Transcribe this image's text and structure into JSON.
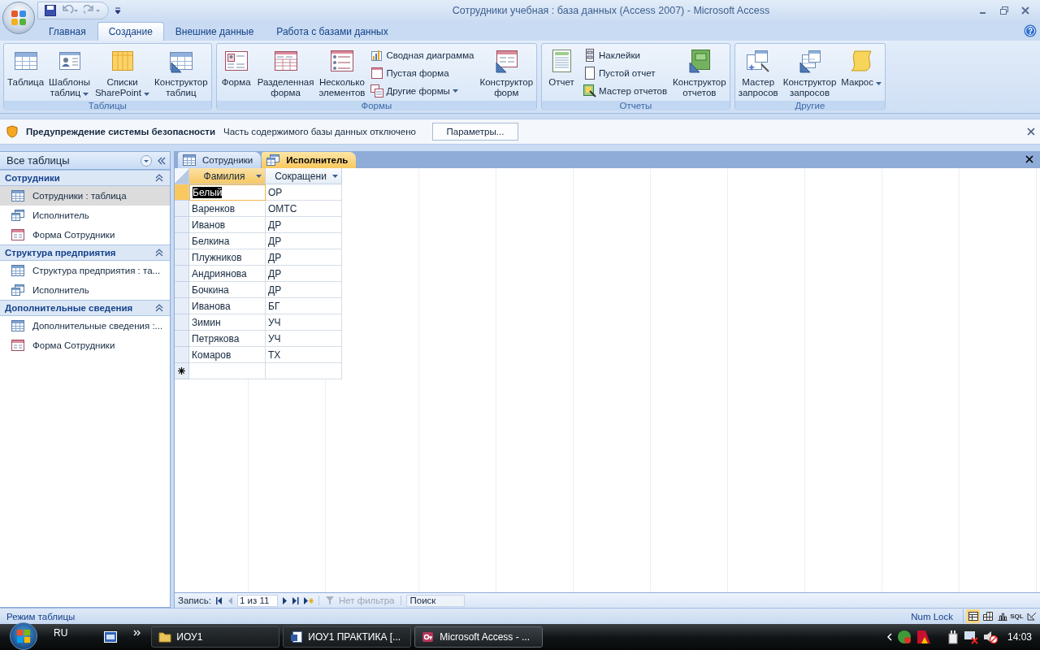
{
  "window": {
    "title": "Сотрудники учебная : база данных (Access 2007) - Microsoft Access"
  },
  "ribbon_tabs": [
    {
      "label": "Главная",
      "selected": false
    },
    {
      "label": "Создание",
      "selected": true
    },
    {
      "label": "Внешние данные",
      "selected": false
    },
    {
      "label": "Работа с базами данных",
      "selected": false
    }
  ],
  "ribbon_groups": [
    {
      "label": "Таблицы",
      "items": [
        {
          "label": "Таблица",
          "kind": "large",
          "dropdown": false
        },
        {
          "label": "Шаблоны\nтаблиц",
          "kind": "large",
          "dropdown": true
        },
        {
          "label": "Списки\nSharePoint",
          "kind": "large",
          "dropdown": true
        },
        {
          "label": "Конструктор\nтаблиц",
          "kind": "large",
          "dropdown": false
        }
      ]
    },
    {
      "label": "Формы",
      "items": [
        {
          "label": "Форма",
          "kind": "large",
          "dropdown": false
        },
        {
          "label": "Разделенная\nформа",
          "kind": "large",
          "dropdown": false
        },
        {
          "label": "Несколько\nэлементов",
          "kind": "large",
          "dropdown": false
        },
        {
          "label": "Сводная диаграмма",
          "kind": "small",
          "dropdown": false
        },
        {
          "label": "Пустая форма",
          "kind": "small",
          "dropdown": false
        },
        {
          "label": "Другие формы",
          "kind": "small",
          "dropdown": true
        },
        {
          "label": "Конструктор\nформ",
          "kind": "large",
          "dropdown": false
        }
      ]
    },
    {
      "label": "Отчеты",
      "items": [
        {
          "label": "Отчет",
          "kind": "large",
          "dropdown": false
        },
        {
          "label": "Наклейки",
          "kind": "small",
          "dropdown": false
        },
        {
          "label": "Пустой отчет",
          "kind": "small",
          "dropdown": false
        },
        {
          "label": "Мастер отчетов",
          "kind": "small",
          "dropdown": false
        },
        {
          "label": "Конструктор\nотчетов",
          "kind": "large",
          "dropdown": false
        }
      ]
    },
    {
      "label": "Другие",
      "items": [
        {
          "label": "Мастер\nзапросов",
          "kind": "large",
          "dropdown": false
        },
        {
          "label": "Конструктор\nзапросов",
          "kind": "large",
          "dropdown": false
        },
        {
          "label": "Макрос",
          "kind": "large",
          "dropdown": true
        }
      ]
    }
  ],
  "security_bar": {
    "title": "Предупреждение системы безопасности",
    "message": "Часть содержимого базы данных отключено",
    "button": "Параметры..."
  },
  "nav_pane": {
    "header": "Все таблицы",
    "groups": [
      {
        "label": "Сотрудники",
        "items": [
          {
            "label": "Сотрудники : таблица",
            "kind": "table",
            "selected": true
          },
          {
            "label": "Исполнитель",
            "kind": "query",
            "selected": false
          },
          {
            "label": "Форма Сотрудники",
            "kind": "form",
            "selected": false
          }
        ]
      },
      {
        "label": "Структура предприятия",
        "items": [
          {
            "label": "Структура предприятия : та...",
            "kind": "table",
            "selected": false
          },
          {
            "label": "Исполнитель",
            "kind": "query",
            "selected": false
          }
        ]
      },
      {
        "label": "Дополнительные сведения",
        "items": [
          {
            "label": "Дополнительные сведения :...",
            "kind": "table",
            "selected": false
          },
          {
            "label": "Форма Сотрудники",
            "kind": "form",
            "selected": false
          }
        ]
      }
    ]
  },
  "doc_tabs": [
    {
      "label": "Сотрудники",
      "kind": "table",
      "selected": false
    },
    {
      "label": "Исполнитель",
      "kind": "query",
      "selected": true
    }
  ],
  "datasheet": {
    "columns": [
      {
        "label": "Фамилия",
        "selected": true
      },
      {
        "label": "Сокращени",
        "selected": false
      }
    ],
    "rows": [
      {
        "cells": [
          "Белый",
          "ОР"
        ],
        "current": true
      },
      {
        "cells": [
          "Варенков",
          "ОМТС"
        ],
        "current": false
      },
      {
        "cells": [
          "Иванов",
          "ДР"
        ],
        "current": false
      },
      {
        "cells": [
          "Белкина",
          "ДР"
        ],
        "current": false
      },
      {
        "cells": [
          "Плужников",
          "ДР"
        ],
        "current": false
      },
      {
        "cells": [
          "Андриянова",
          "ДР"
        ],
        "current": false
      },
      {
        "cells": [
          "Бочкина",
          "ДР"
        ],
        "current": false
      },
      {
        "cells": [
          "Иванова",
          "БГ"
        ],
        "current": false
      },
      {
        "cells": [
          "Зимин",
          "УЧ"
        ],
        "current": false
      },
      {
        "cells": [
          "Петрякова",
          "УЧ"
        ],
        "current": false
      },
      {
        "cells": [
          "Комаров",
          "ТХ"
        ],
        "current": false
      }
    ]
  },
  "record_nav": {
    "label": "Запись:",
    "position": "1 из 11",
    "filter": "Нет фильтра",
    "filter_disabled": true,
    "search_placeholder": "Поиск"
  },
  "status_bar": {
    "mode": "Режим таблицы",
    "indicator": "Num Lock",
    "views": [
      {
        "kind": "datasheet",
        "selected": true
      },
      {
        "kind": "pivot_table",
        "selected": false
      },
      {
        "kind": "pivot_chart",
        "selected": false
      },
      {
        "kind": "sql",
        "label": "SQL",
        "selected": false
      },
      {
        "kind": "design",
        "selected": false
      }
    ]
  },
  "taskbar": {
    "language": "RU",
    "buttons": [
      {
        "label": "ИОУ1",
        "kind": "folder",
        "selected": false
      },
      {
        "label": "ИОУ1 ПРАКТИКА [...",
        "kind": "document",
        "selected": false
      },
      {
        "label": "Microsoft Access - ...",
        "kind": "access",
        "selected": true
      }
    ],
    "clock": "14:03"
  }
}
